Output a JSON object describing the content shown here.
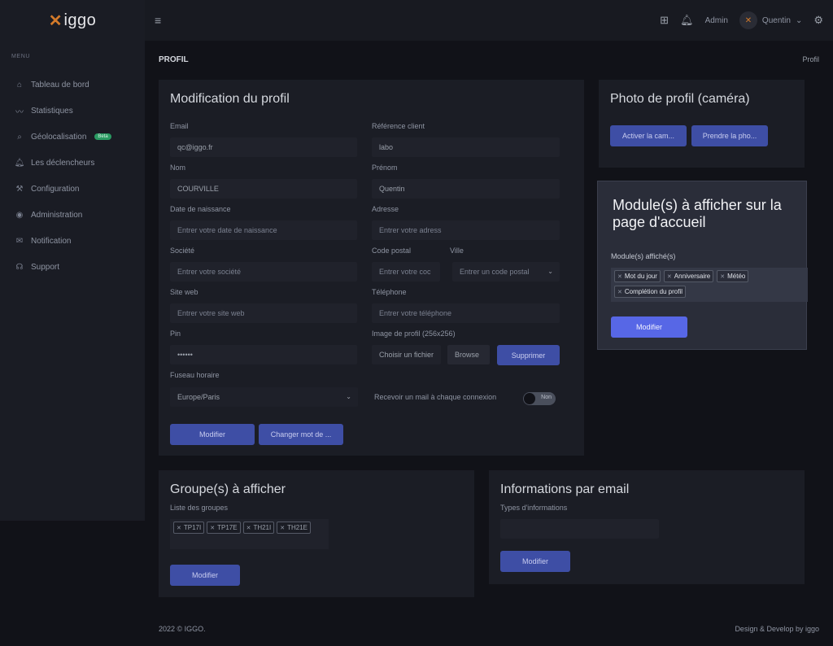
{
  "brand": {
    "mark": "✕",
    "name": "iggo",
    "accent": "#d37a2a"
  },
  "sidebar": {
    "menu_title": "MENU",
    "items": [
      {
        "label": "Tableau de bord",
        "icon": "home-icon"
      },
      {
        "label": "Statistiques",
        "icon": "activity-icon"
      },
      {
        "label": "Géolocalisation",
        "icon": "search-location-icon",
        "badge": "Beta"
      },
      {
        "label": "Les déclencheurs",
        "icon": "bell-icon"
      },
      {
        "label": "Configuration",
        "icon": "wrench-icon"
      },
      {
        "label": "Administration",
        "icon": "user-circle-icon"
      },
      {
        "label": "Notification",
        "icon": "mail-icon"
      },
      {
        "label": "Support",
        "icon": "headset-icon"
      }
    ]
  },
  "topbar": {
    "admin_label": "Admin",
    "user_name": "Quentin"
  },
  "page": {
    "title": "PROFIL",
    "breadcrumb": "Profil"
  },
  "profile_form": {
    "title": "Modification du profil",
    "email_label": "Email",
    "email_value": "qc@iggo.fr",
    "ref_label": "Référence client",
    "ref_value": "labo",
    "nom_label": "Nom",
    "nom_value": "COURVILLE",
    "prenom_label": "Prénom",
    "prenom_value": "Quentin",
    "birth_label": "Date de naissance",
    "birth_placeholder": "Entrer votre date de naissance",
    "address_label": "Adresse",
    "address_placeholder": "Entrer votre adress",
    "company_label": "Société",
    "company_placeholder": "Entrer votre société",
    "postal_label": "Code postal",
    "postal_placeholder": "Entrer votre coc",
    "city_label": "Ville",
    "city_placeholder": "Entrer un code postal",
    "website_label": "Site web",
    "website_placeholder": "Entrer votre site web",
    "phone_label": "Téléphone",
    "phone_placeholder": "Entrer votre téléphone",
    "pin_label": "Pin",
    "pin_value": "••••••",
    "image_label": "Image de profil (256x256)",
    "file_label": "Choisir un fichier",
    "browse_label": "Browse",
    "delete_label": "Supprimer",
    "timezone_label": "Fuseau horaire",
    "timezone_value": "Europe/Paris",
    "mail_toggle_label": "Recevoir un mail à chaque connexion",
    "toggle_value": "Non",
    "save_label": "Modifier",
    "change_password_label": "Changer mot de ..."
  },
  "camera": {
    "title": "Photo de profil (caméra)",
    "activate_label": "Activer la cam...",
    "capture_label": "Prendre la pho..."
  },
  "modules_modal": {
    "title": "Module(s) à afficher sur la page d'accueil",
    "field_label": "Module(s) affiché(s)",
    "tags": [
      "Mot du jour",
      "Anniversaire",
      "Météo",
      "Complétion du profil"
    ],
    "save_label": "Modifier"
  },
  "groups": {
    "title": "Groupe(s) à afficher",
    "list_label": "Liste des groupes",
    "tags": [
      "TP17I",
      "TP17E",
      "TH21I",
      "TH21E"
    ],
    "save_label": "Modifier"
  },
  "email_info": {
    "title": "Informations par email",
    "types_label": "Types d'informations",
    "save_label": "Modifier"
  },
  "footer": {
    "left": "2022 © IGGO.",
    "right": "Design & Develop by iggo"
  }
}
